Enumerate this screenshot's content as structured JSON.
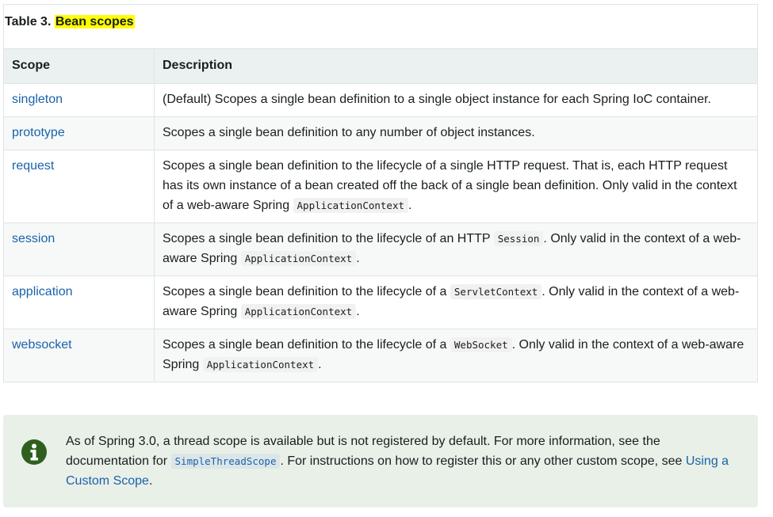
{
  "table": {
    "caption_prefix": "Table 3. ",
    "caption_title": "Bean scopes",
    "headers": {
      "scope": "Scope",
      "description": "Description"
    },
    "rows": [
      {
        "scope": "singleton",
        "desc": [
          {
            "text": "(Default) Scopes a single bean definition to a single object instance for each Spring IoC container."
          }
        ]
      },
      {
        "scope": "prototype",
        "desc": [
          {
            "text": "Scopes a single bean definition to any number of object instances."
          }
        ]
      },
      {
        "scope": "request",
        "desc": [
          {
            "text": "Scopes a single bean definition to the lifecycle of a single HTTP request. That is, each HTTP request has its own instance of a bean created off the back of a single bean definition. Only valid in the context of a web-aware Spring "
          },
          {
            "code": "ApplicationContext"
          },
          {
            "text": "."
          }
        ]
      },
      {
        "scope": "session",
        "desc": [
          {
            "text": "Scopes a single bean definition to the lifecycle of an HTTP "
          },
          {
            "code": "Session"
          },
          {
            "text": ". Only valid in the context of a web-aware Spring "
          },
          {
            "code": "ApplicationContext"
          },
          {
            "text": "."
          }
        ]
      },
      {
        "scope": "application",
        "desc": [
          {
            "text": "Scopes a single bean definition to the lifecycle of a "
          },
          {
            "code": "ServletContext"
          },
          {
            "text": ". Only valid in the context of a web-aware Spring "
          },
          {
            "code": "ApplicationContext"
          },
          {
            "text": "."
          }
        ]
      },
      {
        "scope": "websocket",
        "desc": [
          {
            "text": "Scopes a single bean definition to the lifecycle of a "
          },
          {
            "code": "WebSocket"
          },
          {
            "text": ". Only valid in the context of a web-aware Spring "
          },
          {
            "code": "ApplicationContext"
          },
          {
            "text": "."
          }
        ]
      }
    ]
  },
  "note": {
    "icon": "info-circle-icon",
    "text_1": "As of Spring 3.0, a thread scope is available but is not registered by default. For more information, see the documentation for ",
    "code": "SimpleThreadScope",
    "text_2": ". For instructions on how to register this or any other custom scope, see ",
    "link": "Using a Custom Scope",
    "text_3": "."
  },
  "colors": {
    "link": "#1a62ab",
    "highlight": "#ffff00",
    "header_bg": "#ebf1f1",
    "note_bg": "#e9f0e8",
    "note_icon": "#2f5f1e"
  }
}
